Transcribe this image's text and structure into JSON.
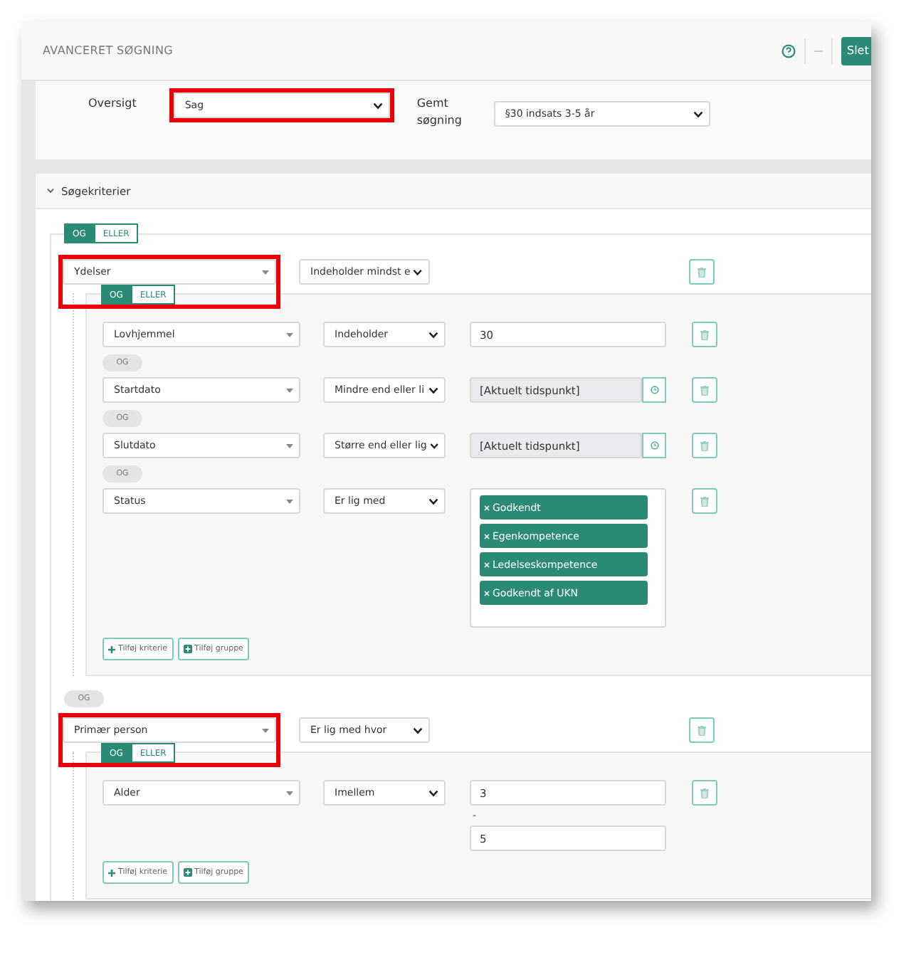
{
  "window": {
    "title": "AVANCERET SØGNING"
  },
  "toolbar": {
    "delete_button": "Slet"
  },
  "overview": {
    "label": "Oversigt",
    "value": "Sag",
    "highlighted": true
  },
  "saved_search": {
    "label": "Gemt søgning",
    "value": "§30 indsats 3-5 år",
    "highlighted": false
  },
  "criteria": {
    "title": "Søgekriterier",
    "expanded": true,
    "logic": [
      {
        "label": "OG",
        "selected": true
      },
      {
        "label": "ELLER",
        "selected": false
      }
    ],
    "groups": [
      {
        "field": "Ydelser",
        "operator": "Indeholder mindst e",
        "highlighted": true,
        "logic": [
          {
            "label": "OG",
            "selected": true
          },
          {
            "label": "ELLER",
            "selected": false
          }
        ],
        "rows": [
          {
            "kind": "text",
            "field": "Lovhjemmel",
            "operator": "Indeholder",
            "value": "30"
          },
          {
            "kind": "date",
            "connector": "OG",
            "field": "Startdato",
            "operator": "Mindre end eller li",
            "value": "[Aktuelt tidspunkt]"
          },
          {
            "kind": "date",
            "connector": "OG",
            "field": "Slutdato",
            "operator": "Større end eller lig",
            "value": "[Aktuelt tidspunkt]"
          },
          {
            "kind": "tags",
            "connector": "OG",
            "field": "Status",
            "operator": "Er lig med",
            "tags": [
              "Godkendt",
              "Egenkompetence",
              "Ledelseskompetence",
              "Godkendt af UKN"
            ]
          }
        ],
        "buttons": [
          "Tilføj kriterie",
          "Tilføj gruppe"
        ]
      },
      {
        "connector": "OG",
        "field": "Primær person",
        "operator": "Er lig med hvor",
        "highlighted": true,
        "logic": [
          {
            "label": "OG",
            "selected": true
          },
          {
            "label": "ELLER",
            "selected": false
          }
        ],
        "rows": [
          {
            "kind": "range",
            "field": "Alder",
            "operator": "Imellem",
            "value": "3",
            "separator": "-",
            "value_to": "5"
          }
        ],
        "buttons": [
          "Tilføj kriterie",
          "Tilføj gruppe"
        ]
      }
    ]
  }
}
